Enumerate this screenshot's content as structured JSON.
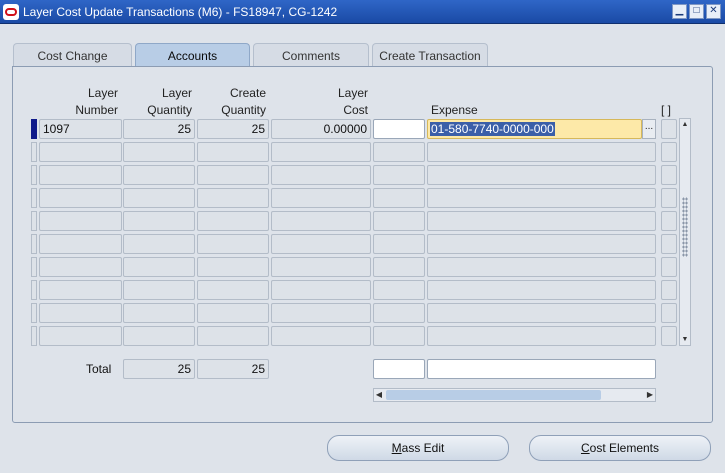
{
  "window": {
    "title": "Layer Cost Update Transactions (M6) - FS18947, CG-1242",
    "buttons": {
      "minimize": "▁",
      "maximize": "□",
      "close": "✕"
    }
  },
  "tabs": [
    {
      "label": "Cost Change"
    },
    {
      "label": "Accounts"
    },
    {
      "label": "Comments"
    },
    {
      "label": "Create Transaction"
    }
  ],
  "columns": {
    "layer_number": [
      "Layer",
      "Number"
    ],
    "layer_quantity": [
      "Layer",
      "Quantity"
    ],
    "create_quantity": [
      "Create",
      "Quantity"
    ],
    "layer_cost": [
      "Layer",
      "Cost"
    ],
    "expense": "Expense",
    "flex": "[ ]"
  },
  "rows": [
    {
      "layer_number": "1097",
      "layer_quantity": "25",
      "create_quantity": "25",
      "layer_cost": "0.00000",
      "expense": "01-580-7740-0000-000"
    }
  ],
  "totals": {
    "label": "Total",
    "layer_quantity": "25",
    "create_quantity": "25"
  },
  "lov_symbol": "...",
  "footer_buttons": {
    "mass_edit": {
      "accel": "M",
      "rest": "ass Edit"
    },
    "cost_elements": {
      "accel": "C",
      "rest": "ost Elements"
    }
  },
  "icons": {
    "app": "oracle-icon",
    "scroll_up": "▲",
    "scroll_down": "▼",
    "scroll_left": "◀",
    "scroll_right": "▶"
  }
}
